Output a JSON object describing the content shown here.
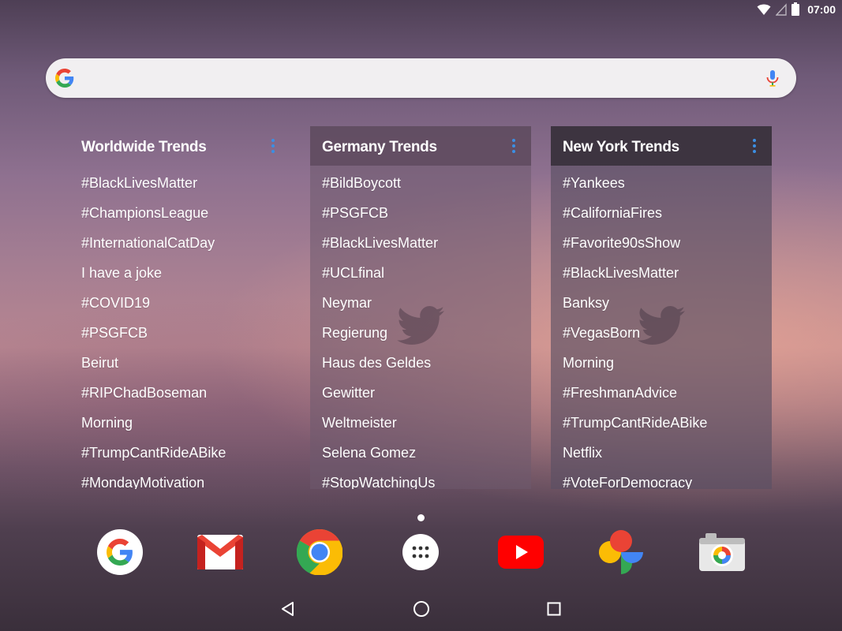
{
  "status_bar": {
    "time": "07:00"
  },
  "search": {
    "placeholder": ""
  },
  "widgets": [
    {
      "title": "Worldwide Trends",
      "trends": [
        "#BlackLivesMatter",
        "#ChampionsLeague",
        "#InternationalCatDay",
        "I have a joke",
        "#COVID19",
        "#PSGFCB",
        "Beirut",
        "#RIPChadBoseman",
        "Morning",
        "#TrumpCantRideABike",
        "#MondayMotivation"
      ]
    },
    {
      "title": "Germany Trends",
      "trends": [
        "#BildBoycott",
        "#PSGFCB",
        "#BlackLivesMatter",
        "#UCLfinal",
        "Neymar",
        "Regierung",
        "Haus des Geldes",
        "Gewitter",
        "Weltmeister",
        "Selena Gomez",
        "#StopWatchingUs"
      ]
    },
    {
      "title": "New York Trends",
      "trends": [
        "#Yankees",
        "#CaliforniaFires",
        "#Favorite90sShow",
        "#BlackLivesMatter",
        "Banksy",
        "#VegasBorn",
        "Morning",
        "#FreshmanAdvice",
        "#TrumpCantRideABike",
        "Netflix",
        "#VoteForDemocracy"
      ]
    }
  ],
  "dock": [
    {
      "icon": "google-icon"
    },
    {
      "icon": "gmail-icon"
    },
    {
      "icon": "chrome-icon"
    },
    {
      "icon": "app-drawer-icon"
    },
    {
      "icon": "youtube-icon"
    },
    {
      "icon": "photos-icon"
    },
    {
      "icon": "camera-icon"
    }
  ],
  "colors": {
    "accent": "#3b8fe4",
    "google_blue": "#4285f4",
    "google_red": "#ea4335",
    "google_yellow": "#fbbc05",
    "google_green": "#34a853"
  }
}
